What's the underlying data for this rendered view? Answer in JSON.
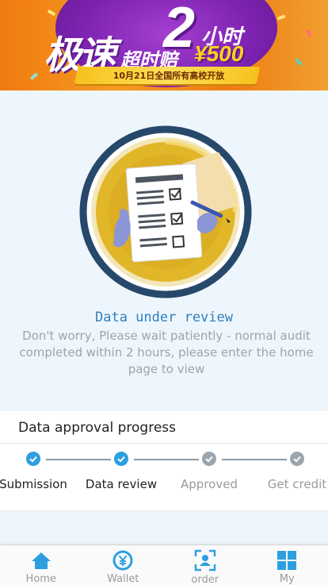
{
  "banner": {
    "headline_a": "极速",
    "headline_num": "2",
    "headline_b": "小时",
    "headline_c": "超时赔",
    "amount": "¥500",
    "ribbon": "10月21日全国所有高校开放"
  },
  "status": {
    "title": "Data under review",
    "message": "Don't worry,  Please wait patiently - normal audit completed within 2 hours, please enter the home page to view"
  },
  "progress": {
    "heading": "Data approval progress",
    "steps": [
      {
        "label": "Submission",
        "state": "done"
      },
      {
        "label": "Data review",
        "state": "done"
      },
      {
        "label": "Approved",
        "state": "pending"
      },
      {
        "label": "Get credit",
        "state": "pending"
      }
    ]
  },
  "colors": {
    "done": "#2d9fe0",
    "pending": "#9aa5ae",
    "tab_icon": "#2d9fe0"
  },
  "tabs": [
    {
      "label": "Home",
      "icon": "home-icon"
    },
    {
      "label": "Wallet",
      "icon": "yen-coin-icon"
    },
    {
      "label": "order",
      "icon": "user-scan-icon"
    },
    {
      "label": "My",
      "icon": "grid-icon"
    }
  ]
}
